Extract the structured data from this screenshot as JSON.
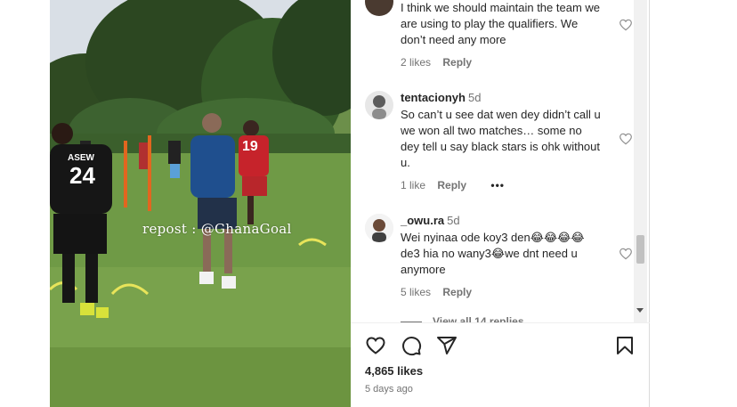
{
  "media": {
    "watermark": "repost : @GhanaGoal",
    "jersey_numbers": [
      "24",
      "19"
    ],
    "jersey_name": "ASEW"
  },
  "comments": [
    {
      "username": "",
      "time": "",
      "text": "I think we should maintain the team we are using to play the qualifiers. We don’t need any more",
      "likes": "2 likes",
      "reply": "Reply"
    },
    {
      "username": "tentacionyh",
      "time": "5d",
      "text": "So can’t u see dat wen dey didn’t call u we won all two matches… some no dey tell u say black stars is ohk without u.",
      "likes": "1 like",
      "reply": "Reply",
      "more": "•••"
    },
    {
      "username": "_owu.ra",
      "time": "5d",
      "text": "Wei nyinaa ode koy3 den😂😂😂😂de3 hia no wany3😂we dnt need u anymore",
      "likes": "5 likes",
      "reply": "Reply"
    }
  ],
  "view_replies": "View all 14 replies",
  "post": {
    "likes": "4,865 likes",
    "date": "5 days ago"
  },
  "icons": {
    "like": "heart-icon",
    "comment": "comment-icon",
    "share": "share-icon",
    "save": "bookmark-icon"
  }
}
